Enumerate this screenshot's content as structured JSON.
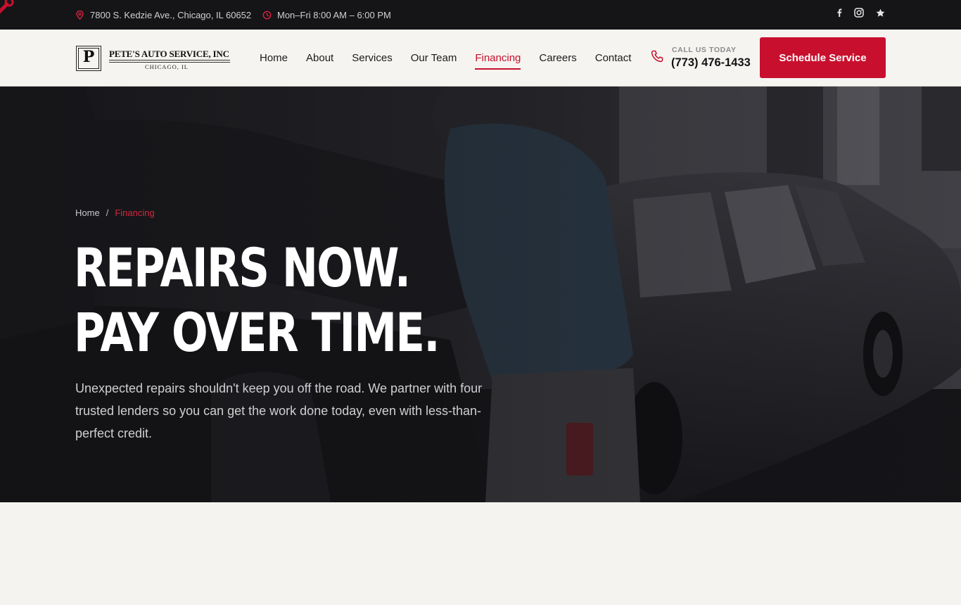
{
  "topbar": {
    "address": "7800 S. Kedzie Ave., Chicago, IL 60652",
    "hours": "Mon–Fri 8:00 AM – 6:00 PM",
    "address_icon": "map-pin-icon",
    "hours_icon": "clock-icon",
    "social": [
      "facebook-icon",
      "instagram-icon",
      "star-icon"
    ]
  },
  "logo": {
    "initial": "P",
    "name": "PETE'S AUTO SERVICE, INC",
    "city": "CHICAGO, IL"
  },
  "nav": {
    "items": [
      "Home",
      "About",
      "Services",
      "Our Team",
      "Financing",
      "Careers",
      "Contact"
    ],
    "active": "Financing"
  },
  "call": {
    "label": "CALL US TODAY",
    "number": "(773) 476-1433",
    "icon": "phone-icon"
  },
  "cta": {
    "label": "Schedule Service"
  },
  "breadcrumb": {
    "home": "Home",
    "separator": "/",
    "current": "Financing"
  },
  "hero": {
    "title_line1": "REPAIRS NOW.",
    "title_line2": "PAY OVER TIME.",
    "subtitle": "Unexpected repairs shouldn't keep you off the road. We partner with four trusted lenders so you can get the work done today, even with less-than-perfect credit."
  },
  "colors": {
    "accent": "#c8102e",
    "topbar_bg": "#151518",
    "header_bg": "#f5f4f0",
    "page_bg": "#f4f3ef"
  }
}
